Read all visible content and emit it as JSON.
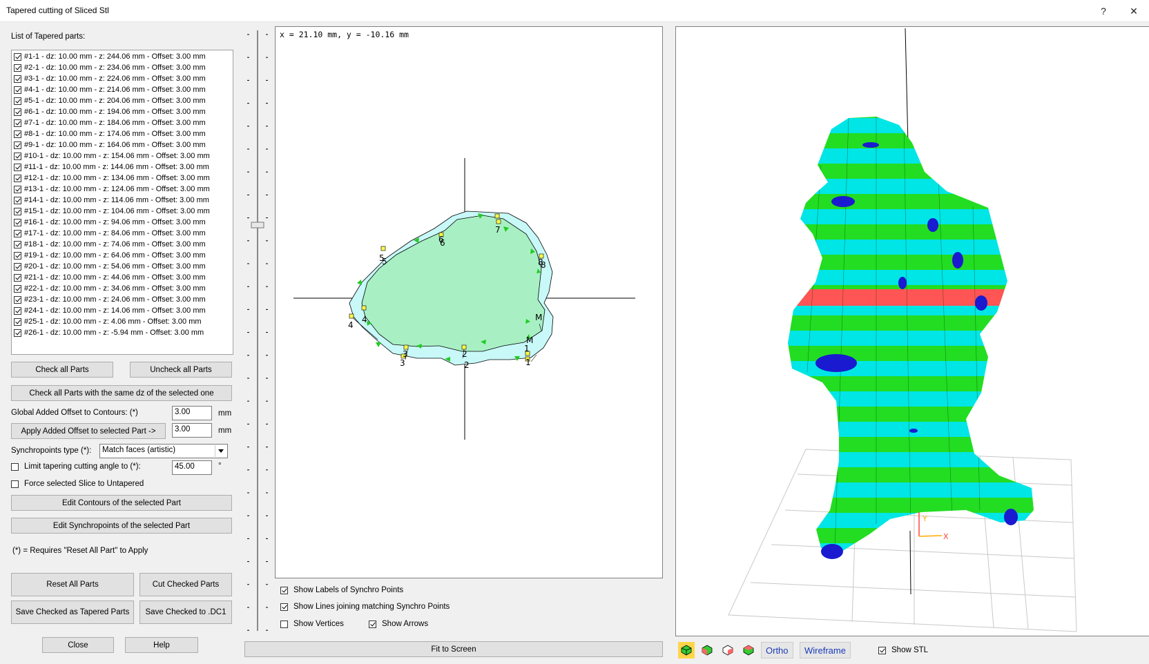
{
  "window": {
    "title": "Tapered cutting of Sliced Stl",
    "help_glyph": "?",
    "close_glyph": "✕"
  },
  "left": {
    "list_label": "List of Tapered parts:",
    "parts": [
      "#1-1 - dz: 10.00 mm - z: 244.06 mm - Offset: 3.00 mm",
      "#2-1 - dz: 10.00 mm - z: 234.06 mm - Offset: 3.00 mm",
      "#3-1 - dz: 10.00 mm - z: 224.06 mm - Offset: 3.00 mm",
      "#4-1 - dz: 10.00 mm - z: 214.06 mm - Offset: 3.00 mm",
      "#5-1 - dz: 10.00 mm - z: 204.06 mm - Offset: 3.00 mm",
      "#6-1 - dz: 10.00 mm - z: 194.06 mm - Offset: 3.00 mm",
      "#7-1 - dz: 10.00 mm - z: 184.06 mm - Offset: 3.00 mm",
      "#8-1 - dz: 10.00 mm - z: 174.06 mm - Offset: 3.00 mm",
      "#9-1 - dz: 10.00 mm - z: 164.06 mm - Offset: 3.00 mm",
      "#10-1 - dz: 10.00 mm - z: 154.06 mm - Offset: 3.00 mm",
      "#11-1 - dz: 10.00 mm - z: 144.06 mm - Offset: 3.00 mm",
      "#12-1 - dz: 10.00 mm - z: 134.06 mm - Offset: 3.00 mm",
      "#13-1 - dz: 10.00 mm - z: 124.06 mm - Offset: 3.00 mm",
      "#14-1 - dz: 10.00 mm - z: 114.06 mm - Offset: 3.00 mm",
      "#15-1 - dz: 10.00 mm - z: 104.06 mm - Offset: 3.00 mm",
      "#16-1 - dz: 10.00 mm - z: 94.06 mm - Offset: 3.00 mm",
      "#17-1 - dz: 10.00 mm - z: 84.06 mm - Offset: 3.00 mm",
      "#18-1 - dz: 10.00 mm - z: 74.06 mm - Offset: 3.00 mm",
      "#19-1 - dz: 10.00 mm - z: 64.06 mm - Offset: 3.00 mm",
      "#20-1 - dz: 10.00 mm - z: 54.06 mm - Offset: 3.00 mm",
      "#21-1 - dz: 10.00 mm - z: 44.06 mm - Offset: 3.00 mm",
      "#22-1 - dz: 10.00 mm - z: 34.06 mm - Offset: 3.00 mm",
      "#23-1 - dz: 10.00 mm - z: 24.06 mm - Offset: 3.00 mm",
      "#24-1 - dz: 10.00 mm - z: 14.06 mm - Offset: 3.00 mm",
      "#25-1 - dz: 10.00 mm - z: 4.06 mm - Offset: 3.00 mm",
      "#26-1 - dz: 10.00 mm - z: -5.94 mm - Offset: 3.00 mm"
    ],
    "check_all": "Check all Parts",
    "uncheck_all": "Uncheck all Parts",
    "check_same_dz": "Check all Parts with the same dz of the selected one",
    "global_offset_label": "Global Added Offset to Contours: (*)",
    "global_offset_value": "3.00",
    "unit_mm": "mm",
    "apply_offset": "Apply Added Offset to selected Part ->",
    "apply_offset_value": "3.00",
    "synchro_label": "Synchropoints type (*):",
    "synchro_value": "Match faces (artistic)",
    "limit_label": "Limit tapering cutting angle to (*):",
    "limit_value": "45.00",
    "degree": "°",
    "force_label": "Force selected Slice to Untapered",
    "edit_contours": "Edit Contours of the selected Part",
    "edit_synchro": "Edit Synchropoints of the selected Part",
    "requires_note": "(*) = Requires \"Reset All Part\" to Apply",
    "reset_all": "Reset All Parts",
    "cut_checked": "Cut Checked Parts",
    "save_tapered": "Save Checked  as Tapered Parts",
    "save_dc1": "Save Checked to .DC1",
    "close": "Close",
    "help": "Help"
  },
  "view2d": {
    "coord": "x = 21.10 mm, y = -10.16 mm",
    "labels": [
      "1",
      "1",
      "2",
      "2",
      "3",
      "3",
      "4",
      "4",
      "5",
      "5",
      "6",
      "6",
      "7",
      "8",
      "8",
      "M",
      "M"
    ],
    "opt_labels": "Show Labels of Synchro Points",
    "opt_lines": "Show Lines joining matching Synchro Points",
    "opt_vertices": "Show Vertices",
    "opt_arrows": "Show Arrows",
    "fit": "Fit to Screen"
  },
  "view3d": {
    "ortho": "Ortho",
    "wireframe": "Wireframe",
    "show_stl": "Show STL",
    "axis_x": "X",
    "axis_y": "Y",
    "colors": {
      "cyan": "#00e5e5",
      "green": "#22dd22",
      "red": "#ff5555",
      "blue": "#1a1ad0"
    }
  }
}
